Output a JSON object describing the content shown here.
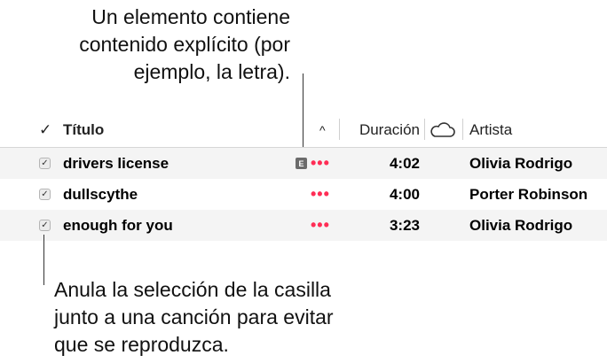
{
  "callouts": {
    "explicit": [
      "Un elemento contiene",
      "contenido explícito (por",
      "ejemplo, la letra)."
    ],
    "checkbox": [
      "Anula la selección de la casilla",
      "junto a una canción para evitar",
      "que se reproduzca."
    ]
  },
  "columns": {
    "check": "✓",
    "title": "Título",
    "sort_indicator": "^",
    "duration": "Duración",
    "cloud_icon": "cloud-icon",
    "artist": "Artista"
  },
  "tracks": [
    {
      "title": "drivers license",
      "explicit": "E",
      "more": "•••",
      "duration": "4:02",
      "artist": "Olivia Rodrigo",
      "checked": "✓"
    },
    {
      "title": "dullscythe",
      "explicit": "",
      "more": "•••",
      "duration": "4:00",
      "artist": "Porter Robinson",
      "checked": "✓"
    },
    {
      "title": "enough for you",
      "explicit": "",
      "more": "•••",
      "duration": "3:23",
      "artist": "Olivia Rodrigo",
      "checked": "✓"
    }
  ],
  "colors": {
    "more_button": "#ff2d55",
    "explicit_badge": "#6b6b6b",
    "row_stripe": "#f4f4f4"
  }
}
